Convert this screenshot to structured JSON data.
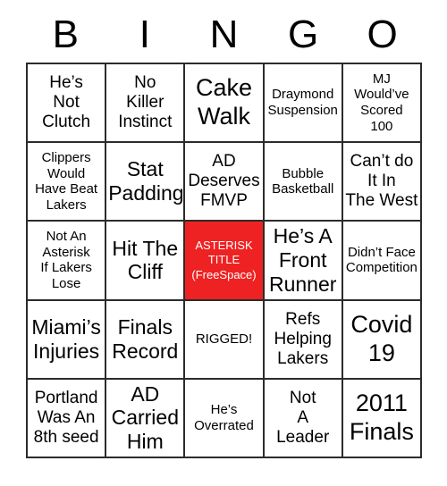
{
  "card": {
    "header_letters": [
      "B",
      "I",
      "N",
      "G",
      "O"
    ],
    "free_space_color": "#ee2222",
    "border_color": "#2b2b2b",
    "text_color": "#000000",
    "free_space_text_color": "#ffffff",
    "rows": [
      [
        {
          "text": "He’s\nNot\nClutch",
          "size": "md",
          "free": false
        },
        {
          "text": "No\nKiller\nInstinct",
          "size": "md",
          "free": false
        },
        {
          "text": "Cake\nWalk",
          "size": "xl",
          "free": false
        },
        {
          "text": "Draymond\nSuspension",
          "size": "sm",
          "free": false
        },
        {
          "text": "MJ\nWould’ve\nScored\n100",
          "size": "sm",
          "free": false
        }
      ],
      [
        {
          "text": "Clippers\nWould\nHave Beat\nLakers",
          "size": "sm",
          "free": false
        },
        {
          "text": "Stat\nPadding",
          "size": "lg",
          "free": false
        },
        {
          "text": "AD\nDeserves\nFMVP",
          "size": "md",
          "free": false
        },
        {
          "text": "Bubble\nBasketball",
          "size": "sm",
          "free": false
        },
        {
          "text": "Can’t do\nIt In\nThe West",
          "size": "md",
          "free": false
        }
      ],
      [
        {
          "text": "Not An\nAsterisk\nIf Lakers\nLose",
          "size": "sm",
          "free": false
        },
        {
          "text": "Hit The\nCliff",
          "size": "lg",
          "free": false
        },
        {
          "text": "ASTERISK\nTITLE\n(FreeSpace)",
          "size": "xs",
          "free": true
        },
        {
          "text": "He’s A\nFront\nRunner",
          "size": "lg",
          "free": false
        },
        {
          "text": "Didn’t Face\nCompetition",
          "size": "sm",
          "free": false
        }
      ],
      [
        {
          "text": "Miami’s\nInjuries",
          "size": "lg",
          "free": false
        },
        {
          "text": "Finals\nRecord",
          "size": "lg",
          "free": false
        },
        {
          "text": "RIGGED!",
          "size": "sm",
          "free": false
        },
        {
          "text": "Refs\nHelping\nLakers",
          "size": "md",
          "free": false
        },
        {
          "text": "Covid\n19",
          "size": "xl",
          "free": false
        }
      ],
      [
        {
          "text": "Portland\nWas An\n8th seed",
          "size": "md",
          "free": false
        },
        {
          "text": "AD\nCarried\nHim",
          "size": "lg",
          "free": false
        },
        {
          "text": "He’s\nOverrated",
          "size": "sm",
          "free": false
        },
        {
          "text": "Not\nA\nLeader",
          "size": "md",
          "free": false
        },
        {
          "text": "2011\nFinals",
          "size": "xl",
          "free": false
        }
      ]
    ]
  }
}
